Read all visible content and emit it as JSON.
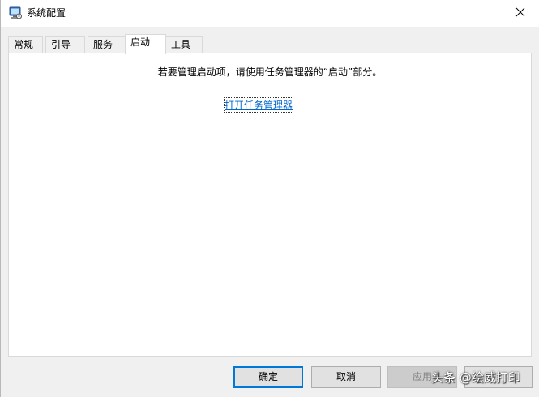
{
  "window": {
    "title": "系统配置"
  },
  "tabs": [
    {
      "label": "常规"
    },
    {
      "label": "引导"
    },
    {
      "label": "服务"
    },
    {
      "label": "启动"
    },
    {
      "label": "工具"
    }
  ],
  "active_tab": "启动",
  "startup_panel": {
    "message": "若要管理启动项，请使用任务管理器的“启动”部分。",
    "link_label": "打开任务管理器"
  },
  "buttons": {
    "ok": "确定",
    "cancel": "取消",
    "apply": "应用"
  },
  "watermark": "头条 @绘威打印",
  "colors": {
    "link": "#0066cc",
    "default_button_border": "#0078d7",
    "panel_background": "#ffffff",
    "window_background": "#f0f0f0"
  },
  "icons": {
    "app": "system-config-icon",
    "close": "close-icon"
  }
}
